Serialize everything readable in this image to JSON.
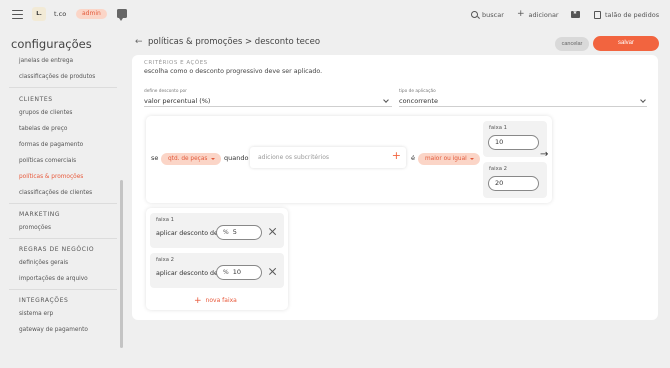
{
  "topbar": {
    "logo_text": "L.",
    "company": "t.co",
    "role_badge": "admin",
    "search_label": "buscar",
    "add_label": "adicionar",
    "orders_label": "talão de pedidos"
  },
  "sidebar": {
    "title": "configurações",
    "items_top": [
      {
        "label": "janelas de entrega"
      },
      {
        "label": "classificações de produtos"
      }
    ],
    "sections": [
      {
        "header": "CLIENTES",
        "items": [
          "grupos de clientes",
          "tabelas de preço",
          "formas de pagamento",
          "políticas comerciais",
          "políticas & promoções",
          "classificações de clientes"
        ]
      },
      {
        "header": "MARKETING",
        "items": [
          "promoções"
        ]
      },
      {
        "header": "REGRAS DE NEGÓCIO",
        "items": [
          "definições gerais",
          "importações de arquivo"
        ]
      },
      {
        "header": "INTEGRAÇÕES",
        "items": [
          "sistema erp",
          "gateway de pagamento"
        ]
      }
    ],
    "active_item": "políticas & promoções"
  },
  "header": {
    "breadcrumb": "políticas & promoções > desconto teceo",
    "cancel_label": "cancelar",
    "save_label": "salvar"
  },
  "criteria": {
    "title": "CRITÉRIOS E AÇÕES",
    "description": "escolha como o desconto progressivo deve ser aplicado.",
    "discount_by_label": "define desconto por",
    "discount_by_value": "valor percentual (%)",
    "application_label": "tipo de aplicação",
    "application_value": "concorrente"
  },
  "rule": {
    "se": "se",
    "criterion": "qtd. de peças",
    "quando": "quando",
    "subcriteria_placeholder": "adicione os subcritérios",
    "e": "é",
    "operator": "maior ou igual",
    "ranges": [
      {
        "label": "faixa 1",
        "value": "10"
      },
      {
        "label": "faixa 2",
        "value": "20"
      }
    ]
  },
  "discounts": {
    "items": [
      {
        "label": "faixa 1",
        "text": "aplicar desconto de",
        "unit": "%",
        "value": "5"
      },
      {
        "label": "faixa 2",
        "text": "aplicar desconto de",
        "unit": "%",
        "value": "10"
      }
    ],
    "new_label": "nova faixa"
  },
  "colors": {
    "accent": "#f2643f",
    "badge_bg": "#fbd5c7",
    "active_text": "#e8593b"
  }
}
